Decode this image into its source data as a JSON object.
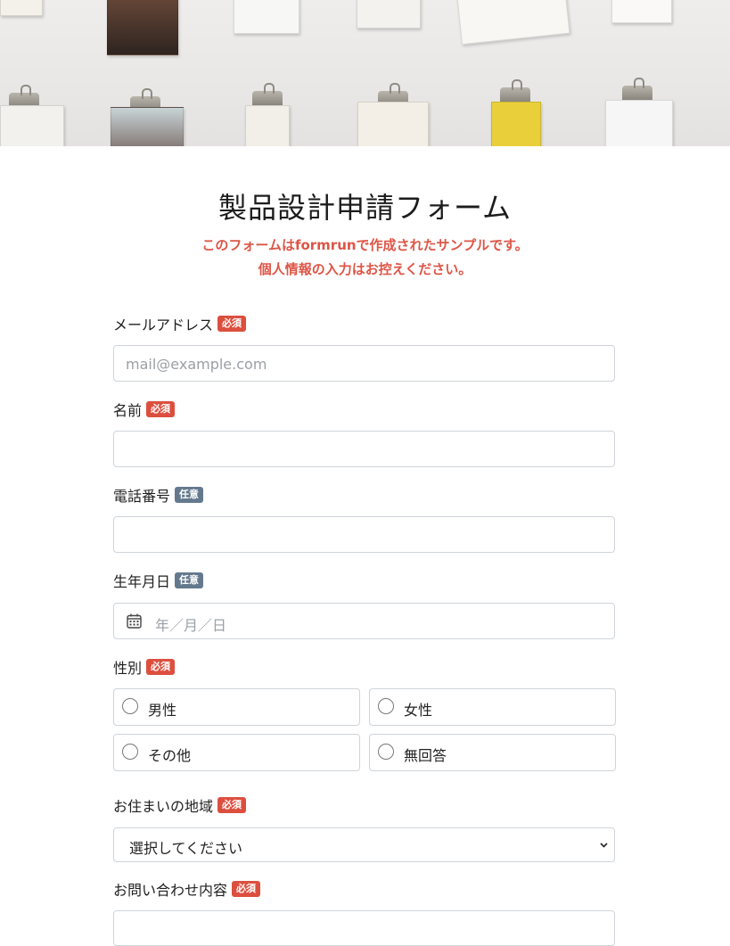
{
  "form": {
    "title": "製品設計申請フォーム",
    "notice_line1": "このフォームはformrunで作成されたサンプルです。",
    "notice_line2": "個人情報の入力はお控えください。",
    "email": {
      "label": "メールアドレス",
      "badge": "必須",
      "placeholder": "mail@example.com"
    },
    "name": {
      "label": "名前",
      "badge": "必須",
      "value": ""
    },
    "phone": {
      "label": "電話番号",
      "badge": "任意",
      "value": ""
    },
    "birthday": {
      "label": "生年月日",
      "badge": "任意",
      "placeholder": "年／月／日",
      "icon": "calendar-icon"
    },
    "gender": {
      "label": "性別",
      "badge": "必須",
      "options": [
        "男性",
        "女性",
        "その他",
        "無回答"
      ]
    },
    "region": {
      "label": "お住まいの地域",
      "badge": "必須",
      "selected": "選択してください",
      "icon": "chevron-down-icon"
    },
    "inquiry": {
      "label": "お問い合わせ内容",
      "badge": "必須"
    }
  },
  "colors": {
    "required_badge": "#dc4f3e",
    "optional_badge": "#64798e",
    "notice": "#de5546"
  }
}
